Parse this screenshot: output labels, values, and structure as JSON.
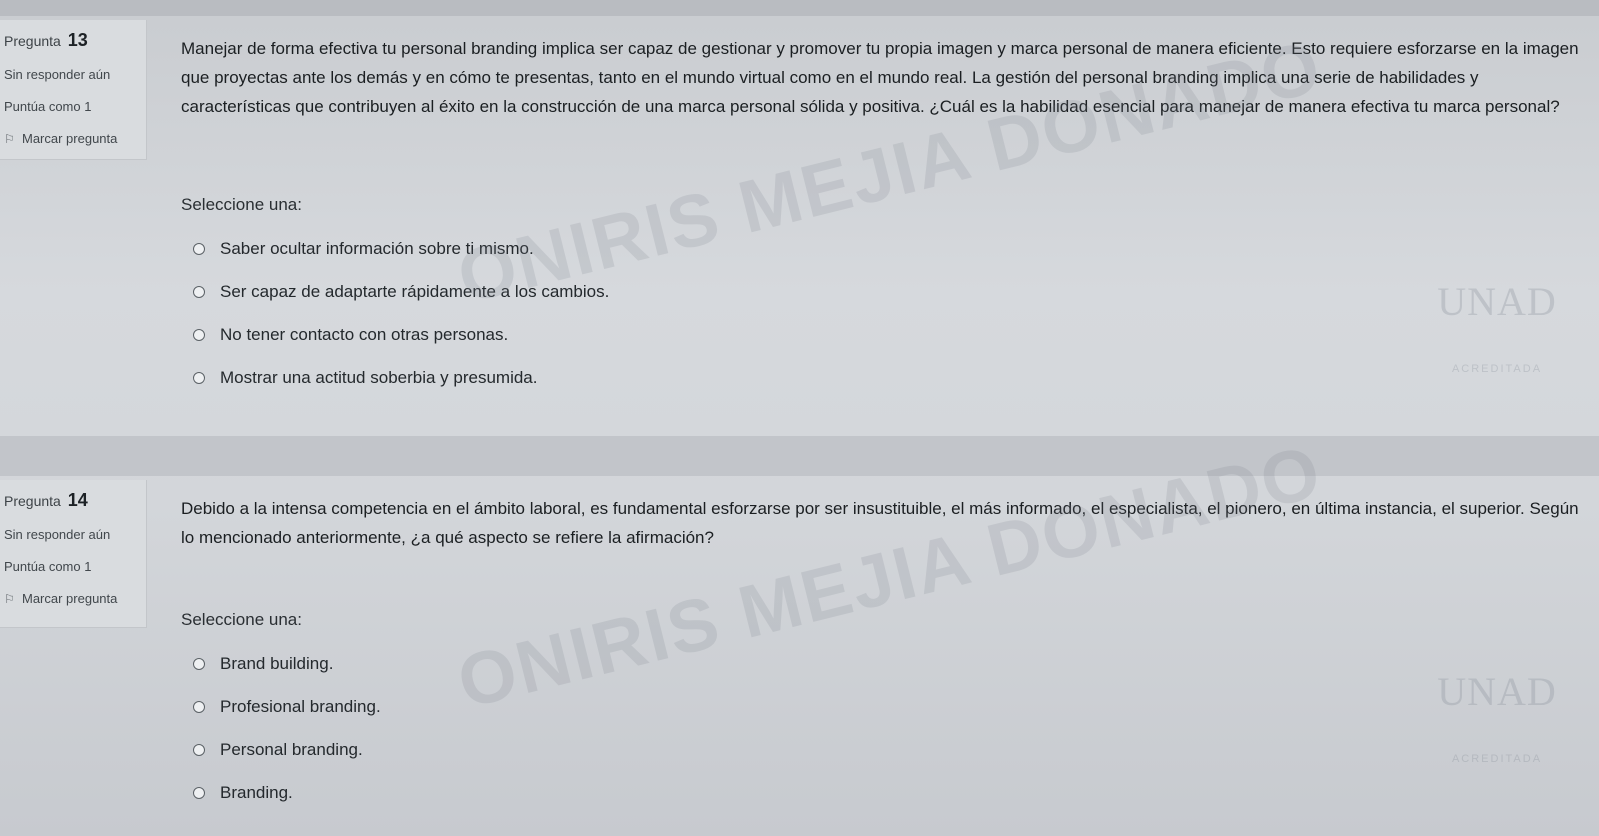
{
  "questions": [
    {
      "label": "Pregunta",
      "number": "13",
      "status": "Sin responder aún",
      "score": "Puntúa como 1",
      "flag_label": "Marcar pregunta",
      "flag_icon": "flag-icon",
      "text": "Manejar de forma efectiva tu personal branding implica ser capaz de gestionar y promover tu propia imagen y marca personal de manera eficiente. Esto requiere esforzarse en la imagen que proyectas ante los demás y en cómo te presentas, tanto en el mundo virtual como en el mundo real. La gestión del personal branding implica una serie de habilidades y características que contribuyen al éxito en la construcción de una marca personal sólida y positiva. ¿Cuál es la habilidad esencial para manejar de manera efectiva tu marca personal?",
      "select_label": "Seleccione una:",
      "options": [
        "Saber ocultar información sobre ti mismo.",
        "Ser capaz de adaptarte rápidamente a los cambios.",
        "No tener contacto con otras personas.",
        "Mostrar una actitud soberbia y presumida."
      ]
    },
    {
      "label": "Pregunta",
      "number": "14",
      "status": "Sin responder aún",
      "score": "Puntúa como 1",
      "flag_label": "Marcar pregunta",
      "flag_icon": "flag-icon",
      "text": "Debido a la intensa competencia en el ámbito laboral, es fundamental esforzarse por ser insustituible, el más informado, el especialista, el pionero, en última instancia, el superior. Según lo mencionado anteriormente, ¿a qué aspecto se refiere la afirmación?",
      "select_label": "Seleccione una:",
      "options": [
        "Brand building.",
        "Profesional branding.",
        "Personal branding.",
        "Branding."
      ]
    }
  ],
  "watermark": "ONIRIS MEJIA DONADO",
  "logo": {
    "mark": "UNAD",
    "sub": "ACREDITADA"
  }
}
